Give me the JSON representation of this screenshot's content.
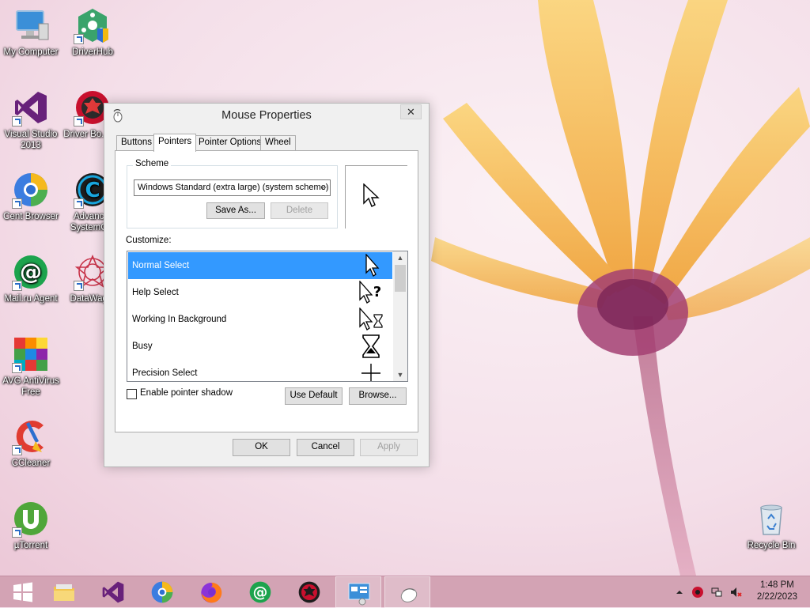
{
  "desktop": {
    "icons": [
      {
        "label": "My Computer",
        "icon": "computer-icon"
      },
      {
        "label": "DriverHub",
        "icon": "driverhub-icon"
      },
      {
        "label": "Visual Studio 2013",
        "icon": "visual-studio-icon"
      },
      {
        "label": "Driver Bo... 10",
        "icon": "driver-booster-icon"
      },
      {
        "label": "Cent Browser",
        "icon": "cent-browser-icon"
      },
      {
        "label": "Advanc... SystemC...",
        "icon": "advanced-systemcare-icon"
      },
      {
        "label": "Mail.ru Agent",
        "icon": "mailru-agent-icon"
      },
      {
        "label": "DataWag...",
        "icon": "datawag-icon"
      },
      {
        "label": "AVG AntiVirus Free",
        "icon": "avg-icon"
      },
      {
        "label": "CCleaner",
        "icon": "ccleaner-icon"
      },
      {
        "label": "µTorrent",
        "icon": "utorrent-icon"
      },
      {
        "label": "Recycle Bin",
        "icon": "recycle-bin-icon"
      }
    ]
  },
  "dialog": {
    "title": "Mouse Properties",
    "close_glyph": "✕",
    "tabs": [
      {
        "label": "Buttons",
        "active": false
      },
      {
        "label": "Pointers",
        "active": true
      },
      {
        "label": "Pointer Options",
        "active": false
      },
      {
        "label": "Wheel",
        "active": false
      }
    ],
    "scheme": {
      "group_label": "Scheme",
      "selected": "Windows Standard (extra large) (system scheme)",
      "save_as_label": "Save As...",
      "delete_label": "Delete"
    },
    "customize_label": "Customize:",
    "cursors": [
      {
        "label": "Normal Select",
        "icon": "arrow-cursor-icon",
        "selected": true
      },
      {
        "label": "Help Select",
        "icon": "help-cursor-icon",
        "selected": false
      },
      {
        "label": "Working In Background",
        "icon": "working-cursor-icon",
        "selected": false
      },
      {
        "label": "Busy",
        "icon": "busy-cursor-icon",
        "selected": false
      },
      {
        "label": "Precision Select",
        "icon": "crosshair-cursor-icon",
        "selected": false
      }
    ],
    "enable_shadow_label": "Enable pointer shadow",
    "enable_shadow_checked": false,
    "use_default_label": "Use Default",
    "browse_label": "Browse...",
    "ok_label": "OK",
    "cancel_label": "Cancel",
    "apply_label": "Apply"
  },
  "taskbar": {
    "pinned": [
      "start-icon",
      "file-explorer-icon",
      "visual-studio-icon",
      "cent-browser-icon",
      "firefox-icon",
      "mailru-agent-icon",
      "driver-booster-icon",
      "control-panel-icon",
      "mouse-icon"
    ],
    "clock_time": "1:48 PM",
    "clock_date": "2/22/2023"
  },
  "colors": {
    "selection": "#3399ff",
    "taskbar": "#d3a3b4",
    "wallpaper": "#f3dde8"
  }
}
